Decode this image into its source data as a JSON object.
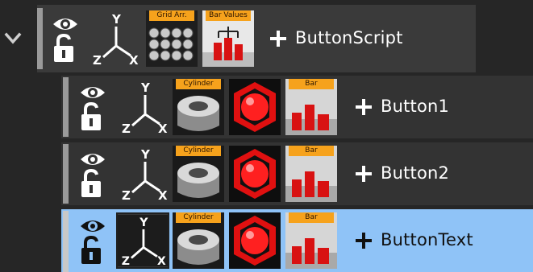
{
  "tree": {
    "parent": {
      "label": "ButtonScript",
      "expanded": true,
      "thumbnails": [
        {
          "tag": "Grid Arr.",
          "icon": "grid-array-spheres"
        },
        {
          "tag": "Bar Values",
          "icon": "bar-values-chart"
        }
      ]
    },
    "children": [
      {
        "label": "Button1",
        "selected": false,
        "thumbnails": [
          {
            "tag": "Cylinder",
            "icon": "cylinder"
          },
          {
            "tag": "",
            "icon": "red-sphere-hexagon"
          },
          {
            "tag": "Bar",
            "icon": "bar-chart"
          }
        ]
      },
      {
        "label": "Button2",
        "selected": false,
        "thumbnails": [
          {
            "tag": "Cylinder",
            "icon": "cylinder"
          },
          {
            "tag": "",
            "icon": "red-sphere-hexagon"
          },
          {
            "tag": "Bar",
            "icon": "bar-chart"
          }
        ]
      },
      {
        "label": "ButtonText",
        "selected": true,
        "thumbnails": [
          {
            "tag": "Cylinder",
            "icon": "cylinder"
          },
          {
            "tag": "",
            "icon": "red-sphere-hexagon"
          },
          {
            "tag": "Bar",
            "icon": "bar-chart"
          }
        ]
      }
    ],
    "axis_labels": {
      "y": "Y",
      "z": "Z",
      "x": "X"
    }
  },
  "colors": {
    "background": "#262626",
    "row": "#333333",
    "selected_row": "#8fc3f7",
    "tag": "#f6a21c",
    "accent_red": "#e01010"
  }
}
